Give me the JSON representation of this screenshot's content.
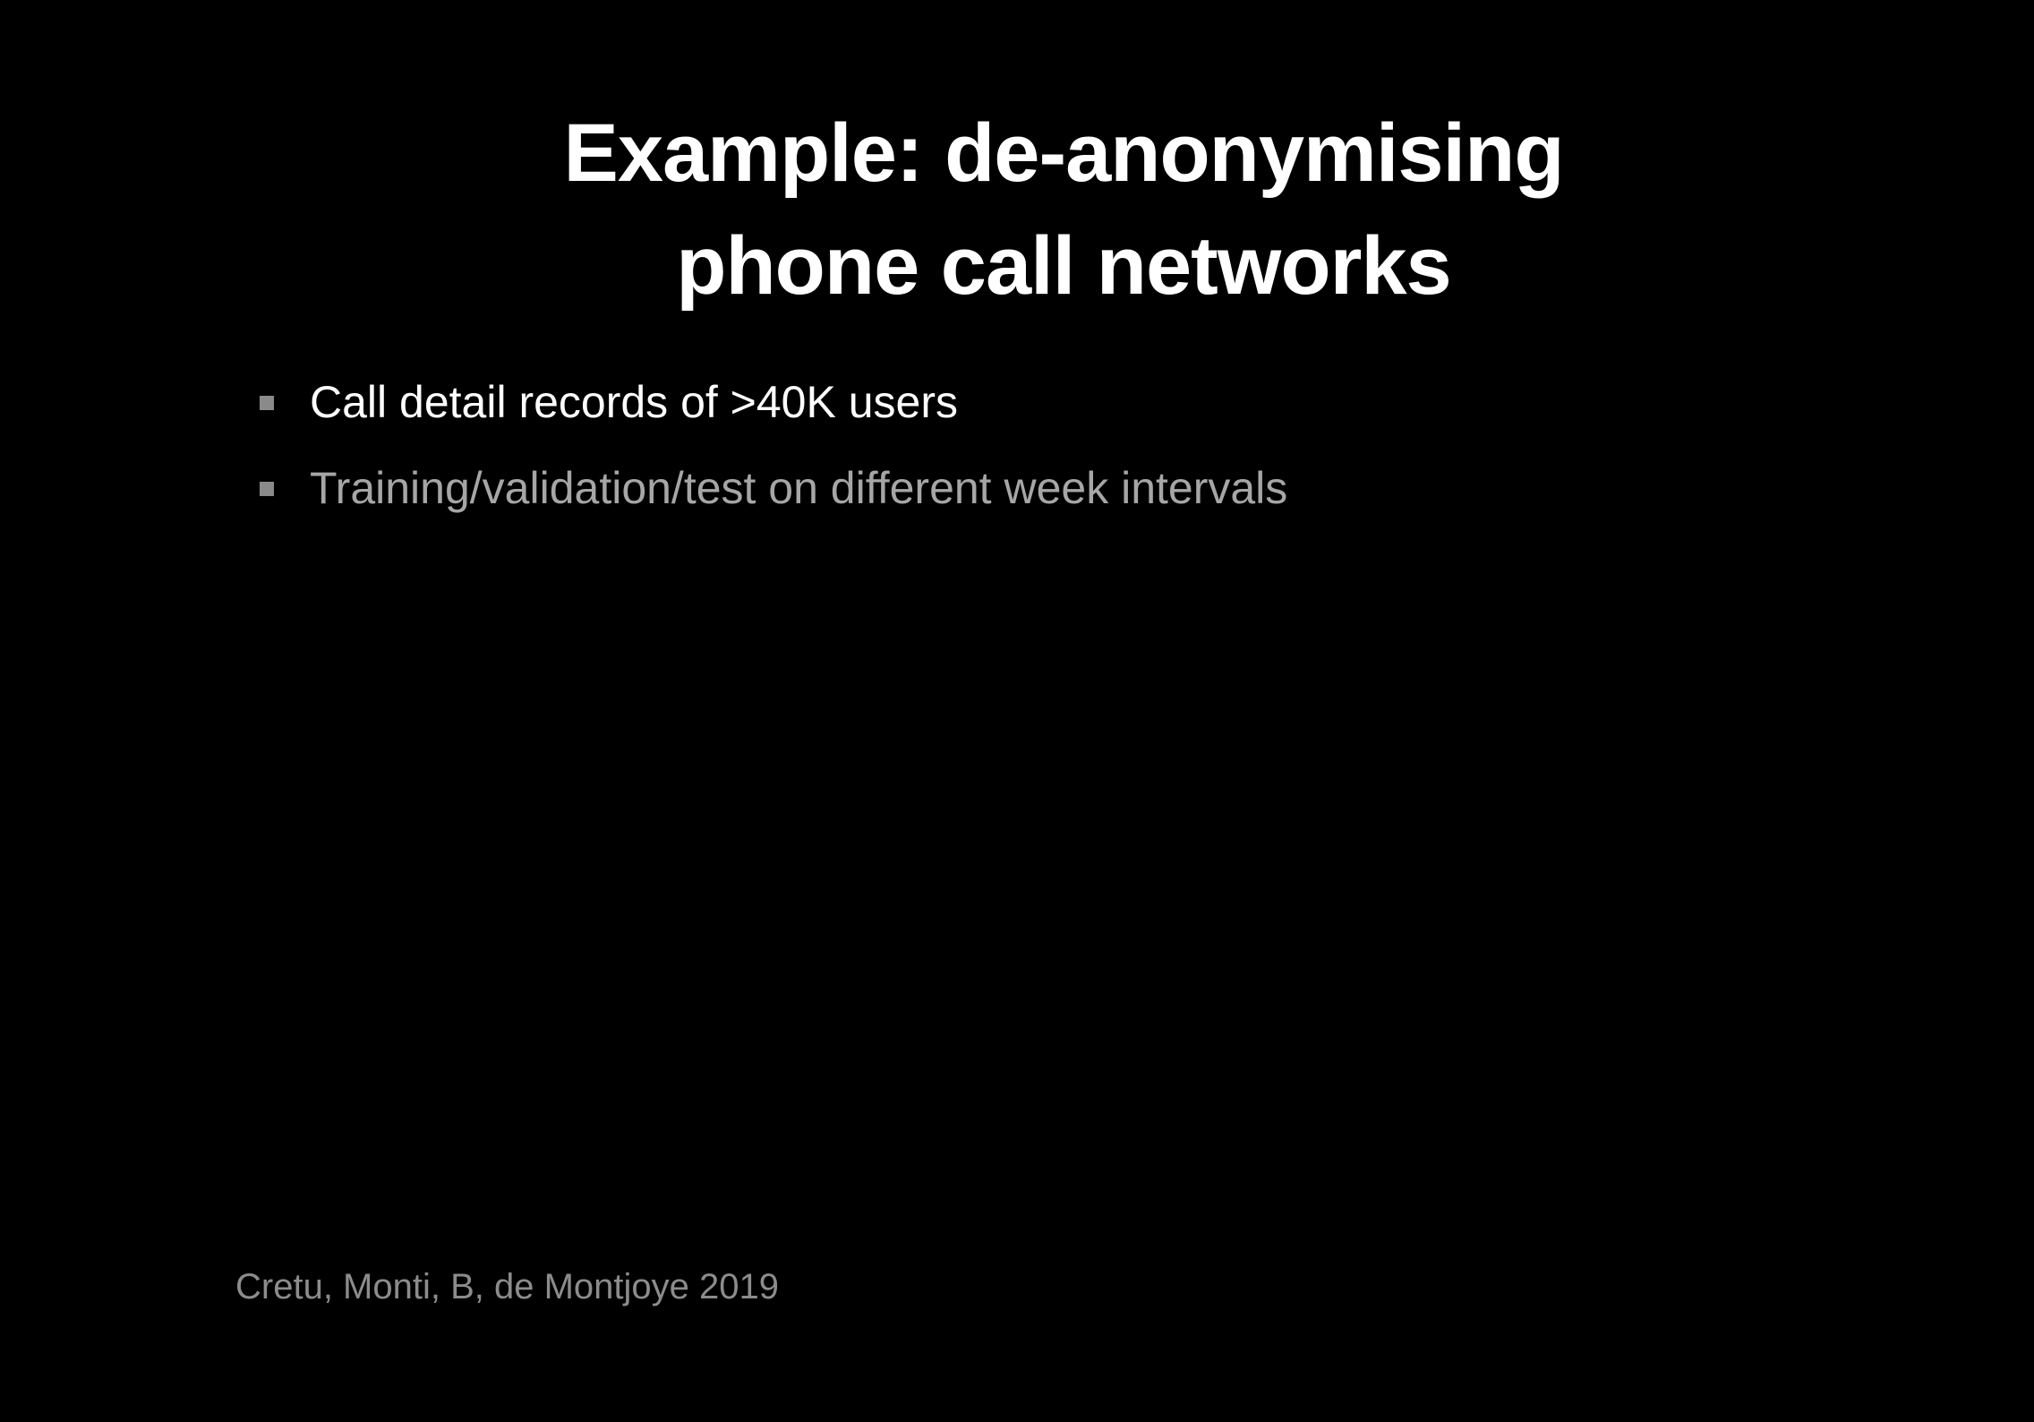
{
  "slide": {
    "title_lines": [
      "Example: de-anonymising",
      "phone call networks"
    ],
    "bullets": [
      {
        "text": "Call detail records of >40K users"
      },
      {
        "text": "Training/validation/test on different week intervals"
      }
    ],
    "citation": "Cretu, Monti, B, de Montjoye 2019"
  },
  "colors": {
    "background": "#000000",
    "title": "#ffffff",
    "bullet_active": "#ffffff",
    "bullet_dimmed": "#a6a6a6",
    "bullet_marker": "#8a8a8a",
    "citation": "#8c8c8c"
  }
}
